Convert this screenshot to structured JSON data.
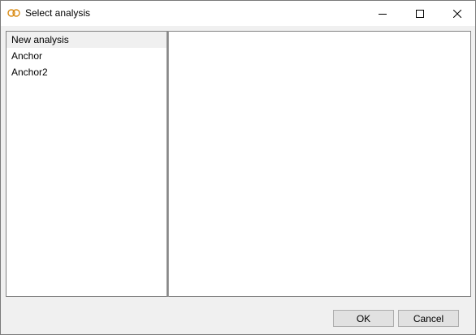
{
  "window": {
    "title": "Select analysis",
    "icon": "rings-icon",
    "controls": [
      "minimize",
      "maximize",
      "close"
    ]
  },
  "analysis_list": {
    "items": [
      {
        "label": "New analysis",
        "selected": true
      },
      {
        "label": "Anchor",
        "selected": false
      },
      {
        "label": "Anchor2",
        "selected": false
      }
    ]
  },
  "buttons": {
    "ok_label": "OK",
    "cancel_label": "Cancel"
  },
  "colors": {
    "icon_accent": "#d98b14",
    "selection_bg": "#f0f0f0",
    "button_bg": "#e1e1e1"
  }
}
